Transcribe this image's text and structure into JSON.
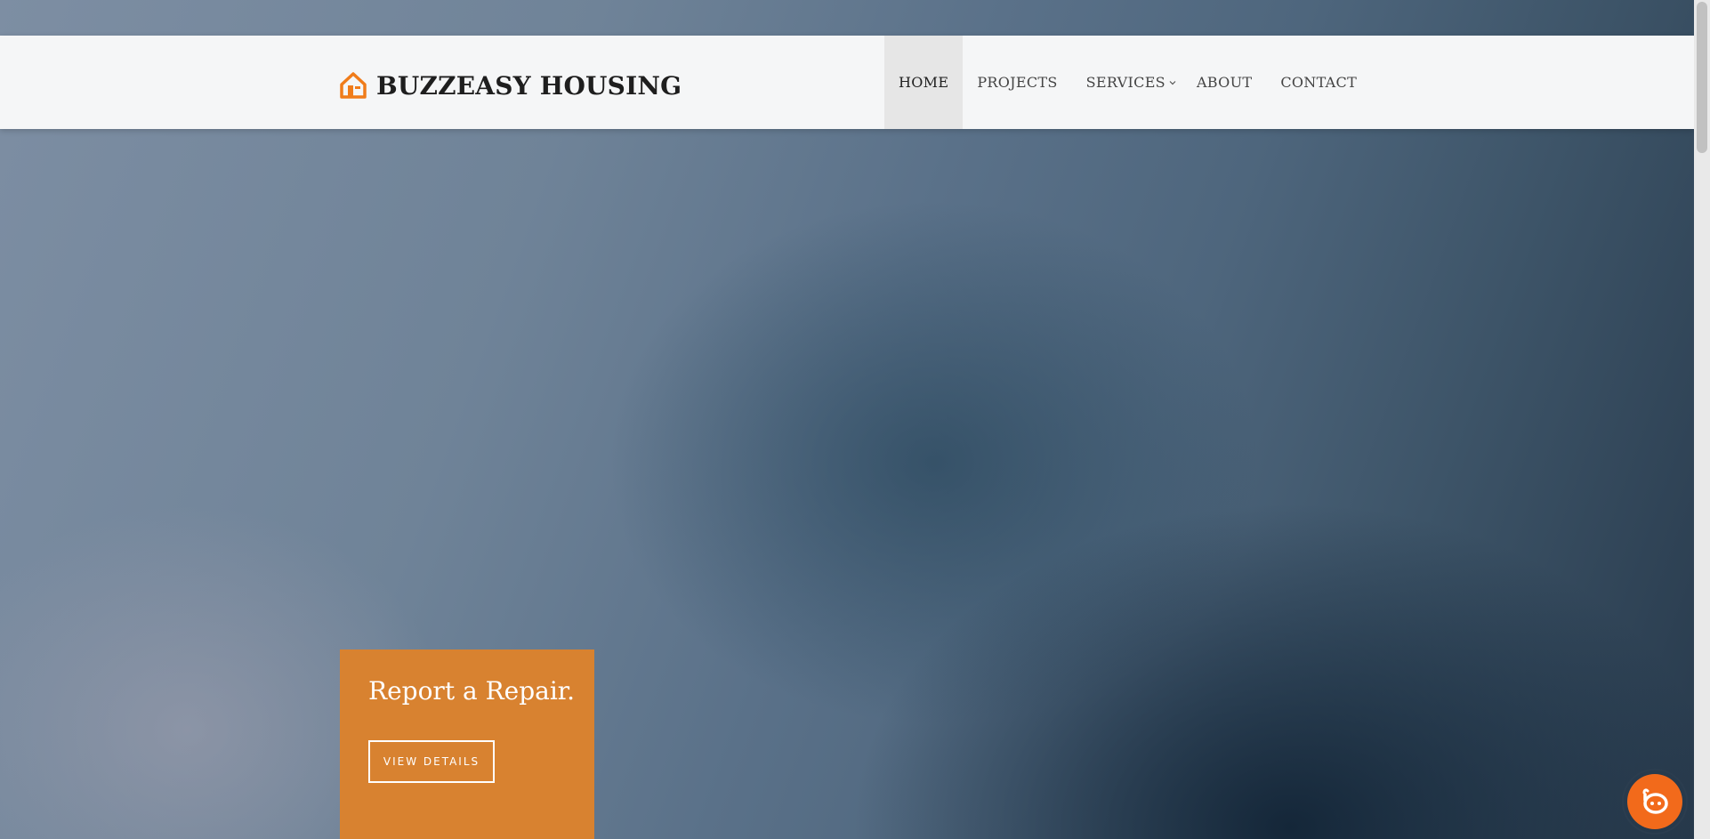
{
  "header": {
    "logo_text": "BUZZEASY HOUSING",
    "logo_icon": "house-icon",
    "accent_color": "#f07c1a",
    "nav": [
      {
        "label": "HOME",
        "active": true
      },
      {
        "label": "PROJECTS",
        "active": false
      },
      {
        "label": "SERVICES",
        "active": false,
        "has_dropdown": true
      },
      {
        "label": "ABOUT",
        "active": false
      },
      {
        "label": "CONTACT",
        "active": false
      }
    ]
  },
  "hero": {
    "promo": {
      "title": "Report a Repair.",
      "button_label": "VIEW DETAILS",
      "background_color": "#d88230"
    }
  },
  "chat_widget": {
    "icon": "chat-bubble-icon",
    "color": "#f26a1b"
  }
}
